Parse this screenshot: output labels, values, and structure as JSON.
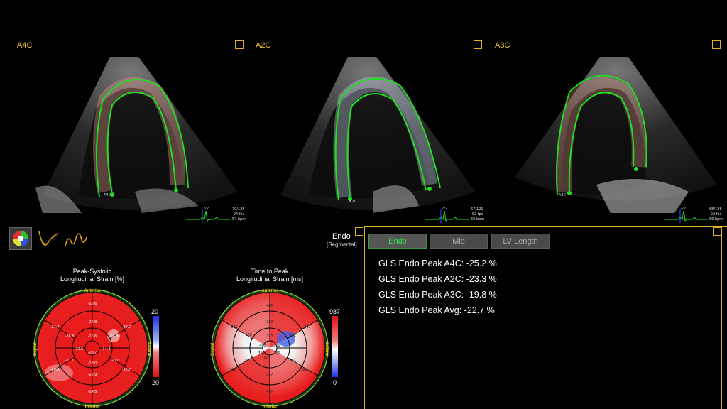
{
  "views": [
    {
      "label": "A4C",
      "ecg": {
        "line1": "70/135",
        "line2": "-94 fps",
        "line3": "57 bpm",
        "tag": "2/2"
      },
      "marker": "A4C"
    },
    {
      "label": "A2C",
      "ecg": {
        "line1": "67/121",
        "line2": "-92 fps",
        "line3": "60 bpm",
        "tag": "2/2"
      },
      "marker": "A2C"
    },
    {
      "label": "A3C",
      "ecg": {
        "line1": "68/128",
        "line2": "-92 fps",
        "line3": "56 bpm",
        "tag": "2/2"
      },
      "marker": "A3C"
    }
  ],
  "tools": {
    "icons": [
      "bullseye-palette-icon",
      "strain-curve-icon",
      "waveform-icon"
    ]
  },
  "bullseye_strain": {
    "title_line1": "Peak-Systolic",
    "title_line2": "Longitudinal Strain [%]",
    "anterior": "Anterior",
    "inferior": "Inferior",
    "septal": "Septal",
    "lateral": "Lateral",
    "scale_max": "20",
    "scale_min": "-20",
    "values": {
      "basal": [
        "-15.6",
        "-32.7",
        "-22.7",
        "-14.5",
        "-10.8",
        "-27.7"
      ],
      "mid": [
        "-22.8",
        "-16.8",
        "-21.8",
        "-22.9",
        "-21.1",
        "-26.8"
      ],
      "apical": [
        "-16.6",
        "-14.4",
        "-13.0",
        "-21.5"
      ],
      "apex": "-23.7"
    }
  },
  "bullseye_ttp": {
    "title_line1": "Time to Peak",
    "title_line2": "Longitudinal Strain [ms]",
    "anterior": "Anterior",
    "inferior": "Inferior",
    "septal": "Septal",
    "lateral": "Lateral",
    "scale_max": "987",
    "scale_min": "0",
    "values": {
      "basal": [
        "486",
        "367",
        "389",
        "437",
        "385",
        "369"
      ],
      "mid": [
        "360",
        "278",
        "383",
        "357",
        "351",
        "428"
      ],
      "apical": [
        "373",
        "369",
        "377",
        "354"
      ],
      "apex": "359"
    },
    "extra": "488"
  },
  "panel": {
    "endo_label": "Endo",
    "segmental_label": "[Segmental]",
    "buttons": [
      {
        "label": "Endo",
        "active": true
      },
      {
        "label": "Mid",
        "active": false
      },
      {
        "label": "LV Length",
        "active": false
      }
    ],
    "gls": [
      "GLS Endo Peak A4C: -25.2 %",
      "GLS Endo Peak A2C: -23.3 %",
      "GLS Endo Peak A3C: -19.8 %",
      "GLS Endo Peak Avg: -22.7 %"
    ]
  },
  "colors": {
    "accent": "#e0b020",
    "trace": "#22dd22",
    "strain_red": "#e81818",
    "ttp_white": "#f2f2f2",
    "ttp_blue": "#2040e0",
    "active_text": "#2fe04a"
  }
}
